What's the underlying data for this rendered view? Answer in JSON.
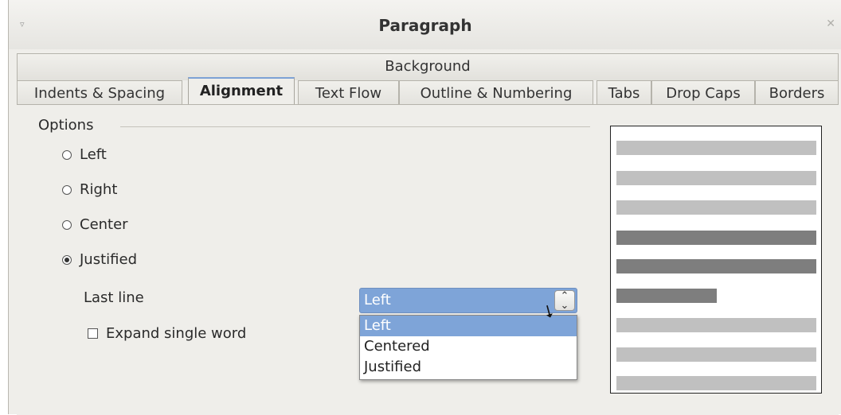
{
  "window": {
    "title": "Paragraph"
  },
  "tabs_row1": [
    {
      "label": "Background"
    }
  ],
  "tabs_row2": [
    {
      "label": "Indents & Spacing",
      "active": false
    },
    {
      "label": "Alignment",
      "active": true
    },
    {
      "label": "Text Flow",
      "active": false
    },
    {
      "label": "Outline & Numbering",
      "active": false
    },
    {
      "label": "Tabs",
      "active": false
    },
    {
      "label": "Drop Caps",
      "active": false
    },
    {
      "label": "Borders",
      "active": false
    }
  ],
  "options": {
    "group_label": "Options",
    "radios": [
      {
        "label": "Left",
        "checked": false
      },
      {
        "label": "Right",
        "checked": false
      },
      {
        "label": "Center",
        "checked": false
      },
      {
        "label": "Justified",
        "checked": true
      }
    ],
    "last_line_label": "Last line",
    "last_line_value": "Left",
    "expand_label": "Expand single word",
    "expand_checked": false
  },
  "dropdown": {
    "options": [
      "Left",
      "Centered",
      "Justified"
    ],
    "selected": "Left"
  },
  "preview": {
    "colors": {
      "light": "#c0c0c0",
      "dark": "#7e7e7e"
    }
  }
}
